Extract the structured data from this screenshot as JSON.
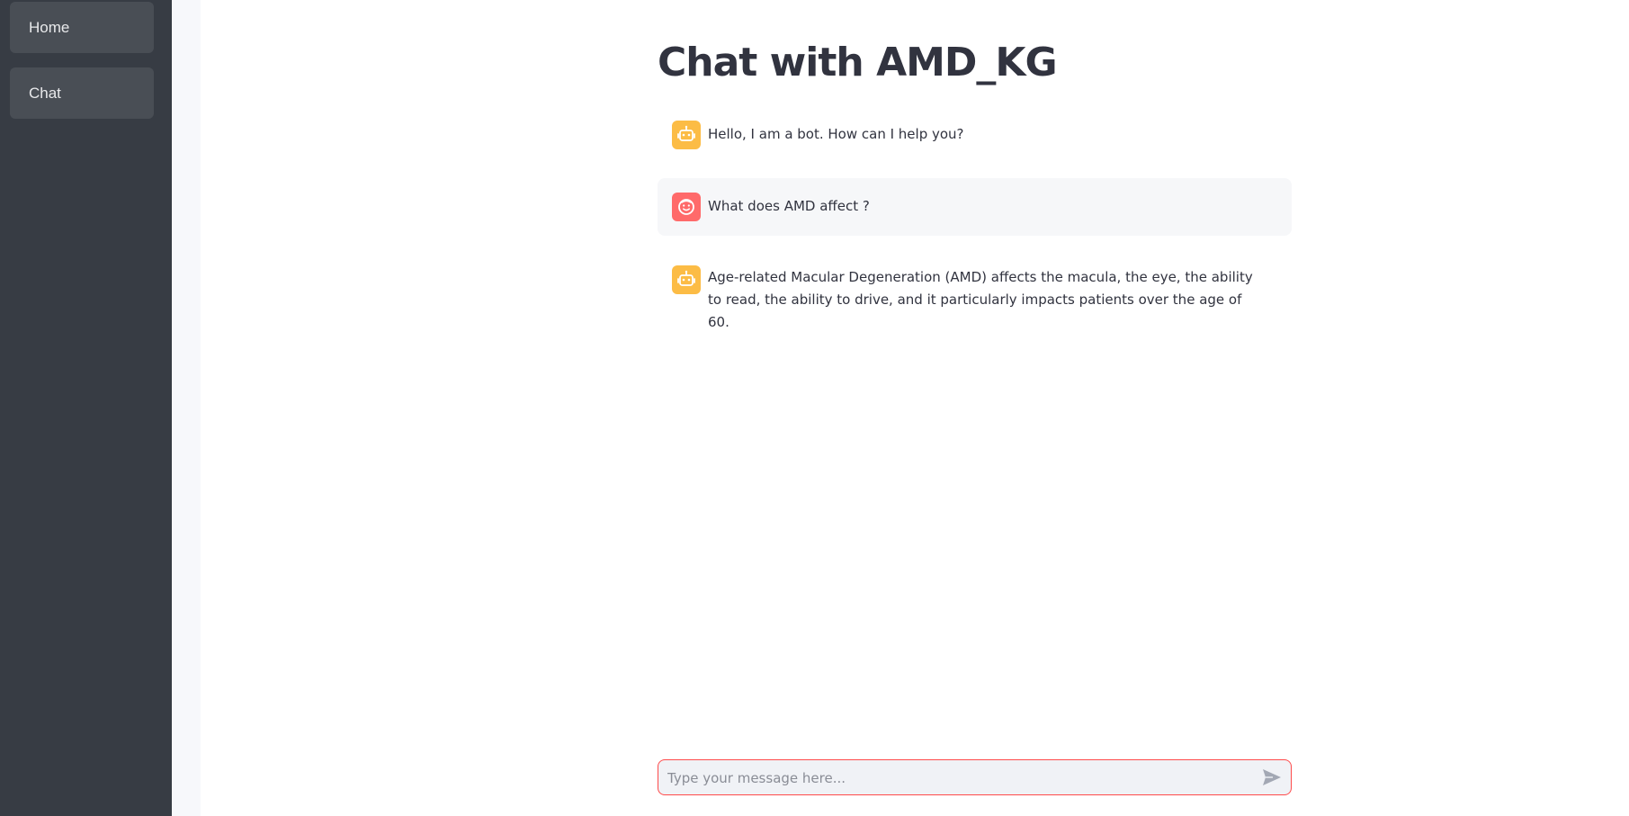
{
  "sidebar": {
    "items": [
      {
        "label": "Home"
      },
      {
        "label": "Chat"
      }
    ]
  },
  "main": {
    "title": "Chat with AMD_KG"
  },
  "messages": [
    {
      "role": "bot",
      "avatar_icon": "robot-icon",
      "text": "Hello, I am a bot. How can I help you?"
    },
    {
      "role": "user",
      "avatar_icon": "smiley-face-icon",
      "text": "What does AMD affect ?"
    },
    {
      "role": "bot",
      "avatar_icon": "robot-icon",
      "text": "Age-related Macular Degeneration (AMD) affects the macula, the eye, the ability to read, the ability to drive, and it particularly impacts patients over the age of 60."
    }
  ],
  "chat_input": {
    "placeholder": "Type your message here...",
    "value": "",
    "send_icon": "send-arrow-icon"
  },
  "colors": {
    "sidebar_bg": "#373c44",
    "nav_item_bg": "#494e55",
    "bot_avatar": "#fcbc45",
    "user_avatar": "#ff6a6a",
    "input_focus_border": "#ff4b4b",
    "text": "#31333f"
  }
}
